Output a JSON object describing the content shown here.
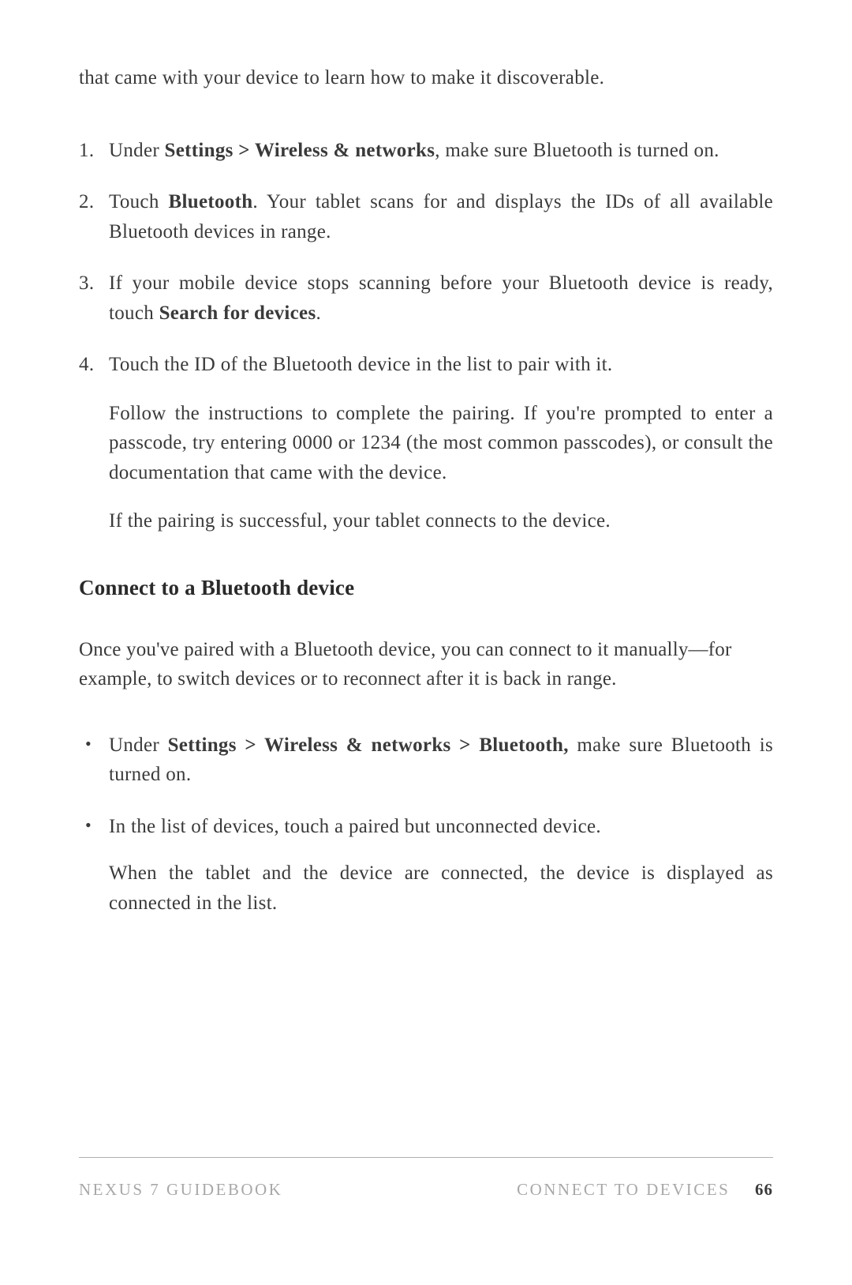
{
  "intro": "that came with your device to learn how to make it discoverable.",
  "steps": [
    {
      "parts": [
        {
          "text": "Under ",
          "bold": false
        },
        {
          "text": "Settings > Wireless & networks",
          "bold": true
        },
        {
          "text": ", make sure Bluetooth is turned on.",
          "bold": false
        }
      ]
    },
    {
      "parts": [
        {
          "text": "Touch ",
          "bold": false
        },
        {
          "text": "Bluetooth",
          "bold": true
        },
        {
          "text": ". Your tablet scans for and displays the IDs of all available Bluetooth devices in range.",
          "bold": false
        }
      ]
    },
    {
      "parts": [
        {
          "text": "If your mobile device stops scanning before your Bluetooth device is ready, touch ",
          "bold": false
        },
        {
          "text": "Search for devices",
          "bold": true
        },
        {
          "text": ".",
          "bold": false
        }
      ]
    },
    {
      "parts": [
        {
          "text": "Touch the ID of the Bluetooth device in the list to pair with it.",
          "bold": false
        }
      ],
      "sub": [
        "Follow the instructions to complete the pairing. If you're prompted to enter a passcode, try entering 0000 or 1234 (the most common passcodes), or consult the documentation that came with the device.",
        "If the pairing is successful, your tablet connects to the device."
      ]
    }
  ],
  "heading": "Connect to a Bluetooth device",
  "body": "Once you've paired with a Bluetooth device, you can connect to it manually—for example, to switch devices or to reconnect after it is back in range.",
  "bullets": [
    {
      "parts": [
        {
          "text": "Under ",
          "bold": false
        },
        {
          "text": "Settings > Wireless & networks > Bluetooth,",
          "bold": true
        },
        {
          "text": " make sure Bluetooth is turned on.",
          "bold": false
        }
      ]
    },
    {
      "parts": [
        {
          "text": "In the list of devices, touch a paired but unconnected device.",
          "bold": false
        }
      ],
      "sub": [
        "When the tablet and the device are connected, the device is displayed as connected in the list."
      ]
    }
  ],
  "footer": {
    "left": "NEXUS 7 GUIDEBOOK",
    "right": "CONNECT TO DEVICES",
    "page": "66"
  }
}
